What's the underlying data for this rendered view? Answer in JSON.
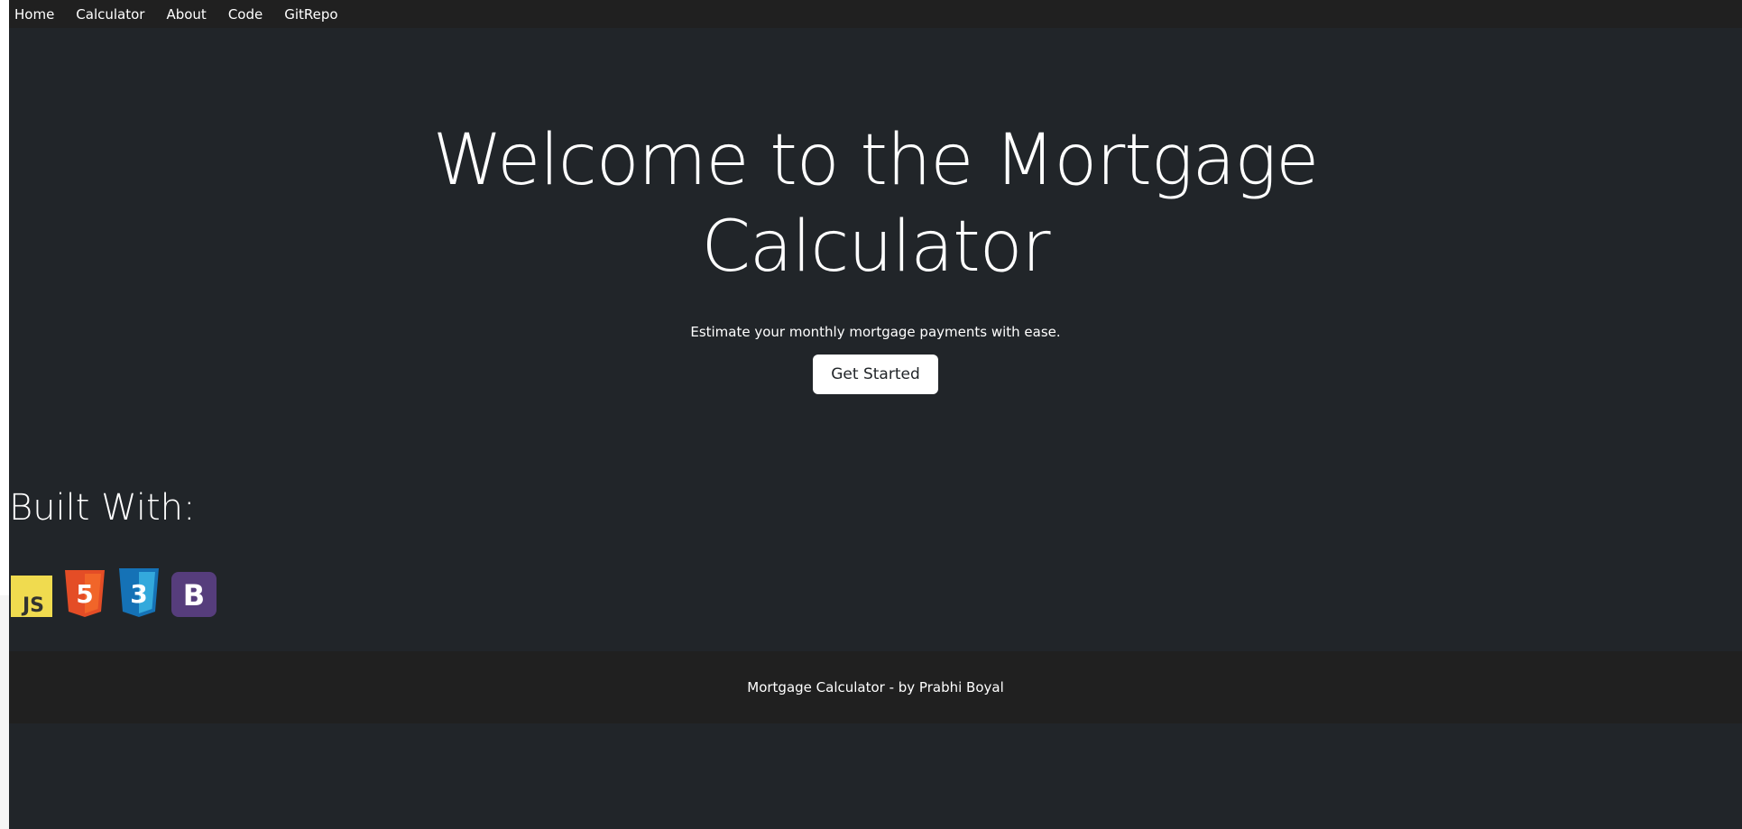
{
  "nav": {
    "items": [
      {
        "label": "Home"
      },
      {
        "label": "Calculator"
      },
      {
        "label": "About"
      },
      {
        "label": "Code"
      },
      {
        "label": "GitRepo"
      }
    ]
  },
  "hero": {
    "title": "Welcome to the Mortgage Calculator",
    "subtitle": "Estimate your monthly mortgage payments with ease.",
    "cta_label": "Get Started"
  },
  "built_with": {
    "heading": "Built With:",
    "logos": [
      {
        "name": "javascript-logo",
        "text": "JS",
        "color": "#F0DB4F"
      },
      {
        "name": "html5-logo",
        "text": "5",
        "color": "#E44D26"
      },
      {
        "name": "css3-logo",
        "text": "3",
        "color": "#1572B6"
      },
      {
        "name": "bootstrap-logo",
        "text": "B",
        "color": "#563D7C"
      }
    ]
  },
  "footer": {
    "text": "Mortgage Calculator - by Prabhi Boyal"
  },
  "colors": {
    "background": "#212529",
    "navbar": "#202020",
    "footer": "#202020",
    "text": "#ffffff"
  }
}
